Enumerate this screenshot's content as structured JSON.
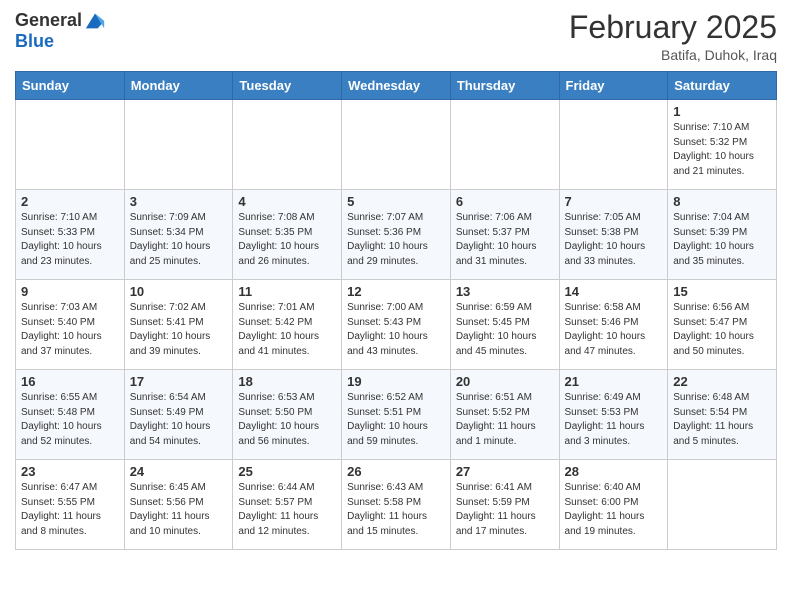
{
  "header": {
    "logo_general": "General",
    "logo_blue": "Blue",
    "month_title": "February 2025",
    "location": "Batifa, Duhok, Iraq"
  },
  "weekdays": [
    "Sunday",
    "Monday",
    "Tuesday",
    "Wednesday",
    "Thursday",
    "Friday",
    "Saturday"
  ],
  "weeks": [
    [
      {
        "day": "",
        "info": ""
      },
      {
        "day": "",
        "info": ""
      },
      {
        "day": "",
        "info": ""
      },
      {
        "day": "",
        "info": ""
      },
      {
        "day": "",
        "info": ""
      },
      {
        "day": "",
        "info": ""
      },
      {
        "day": "1",
        "info": "Sunrise: 7:10 AM\nSunset: 5:32 PM\nDaylight: 10 hours\nand 21 minutes."
      }
    ],
    [
      {
        "day": "2",
        "info": "Sunrise: 7:10 AM\nSunset: 5:33 PM\nDaylight: 10 hours\nand 23 minutes."
      },
      {
        "day": "3",
        "info": "Sunrise: 7:09 AM\nSunset: 5:34 PM\nDaylight: 10 hours\nand 25 minutes."
      },
      {
        "day": "4",
        "info": "Sunrise: 7:08 AM\nSunset: 5:35 PM\nDaylight: 10 hours\nand 26 minutes."
      },
      {
        "day": "5",
        "info": "Sunrise: 7:07 AM\nSunset: 5:36 PM\nDaylight: 10 hours\nand 29 minutes."
      },
      {
        "day": "6",
        "info": "Sunrise: 7:06 AM\nSunset: 5:37 PM\nDaylight: 10 hours\nand 31 minutes."
      },
      {
        "day": "7",
        "info": "Sunrise: 7:05 AM\nSunset: 5:38 PM\nDaylight: 10 hours\nand 33 minutes."
      },
      {
        "day": "8",
        "info": "Sunrise: 7:04 AM\nSunset: 5:39 PM\nDaylight: 10 hours\nand 35 minutes."
      }
    ],
    [
      {
        "day": "9",
        "info": "Sunrise: 7:03 AM\nSunset: 5:40 PM\nDaylight: 10 hours\nand 37 minutes."
      },
      {
        "day": "10",
        "info": "Sunrise: 7:02 AM\nSunset: 5:41 PM\nDaylight: 10 hours\nand 39 minutes."
      },
      {
        "day": "11",
        "info": "Sunrise: 7:01 AM\nSunset: 5:42 PM\nDaylight: 10 hours\nand 41 minutes."
      },
      {
        "day": "12",
        "info": "Sunrise: 7:00 AM\nSunset: 5:43 PM\nDaylight: 10 hours\nand 43 minutes."
      },
      {
        "day": "13",
        "info": "Sunrise: 6:59 AM\nSunset: 5:45 PM\nDaylight: 10 hours\nand 45 minutes."
      },
      {
        "day": "14",
        "info": "Sunrise: 6:58 AM\nSunset: 5:46 PM\nDaylight: 10 hours\nand 47 minutes."
      },
      {
        "day": "15",
        "info": "Sunrise: 6:56 AM\nSunset: 5:47 PM\nDaylight: 10 hours\nand 50 minutes."
      }
    ],
    [
      {
        "day": "16",
        "info": "Sunrise: 6:55 AM\nSunset: 5:48 PM\nDaylight: 10 hours\nand 52 minutes."
      },
      {
        "day": "17",
        "info": "Sunrise: 6:54 AM\nSunset: 5:49 PM\nDaylight: 10 hours\nand 54 minutes."
      },
      {
        "day": "18",
        "info": "Sunrise: 6:53 AM\nSunset: 5:50 PM\nDaylight: 10 hours\nand 56 minutes."
      },
      {
        "day": "19",
        "info": "Sunrise: 6:52 AM\nSunset: 5:51 PM\nDaylight: 10 hours\nand 59 minutes."
      },
      {
        "day": "20",
        "info": "Sunrise: 6:51 AM\nSunset: 5:52 PM\nDaylight: 11 hours\nand 1 minute."
      },
      {
        "day": "21",
        "info": "Sunrise: 6:49 AM\nSunset: 5:53 PM\nDaylight: 11 hours\nand 3 minutes."
      },
      {
        "day": "22",
        "info": "Sunrise: 6:48 AM\nSunset: 5:54 PM\nDaylight: 11 hours\nand 5 minutes."
      }
    ],
    [
      {
        "day": "23",
        "info": "Sunrise: 6:47 AM\nSunset: 5:55 PM\nDaylight: 11 hours\nand 8 minutes."
      },
      {
        "day": "24",
        "info": "Sunrise: 6:45 AM\nSunset: 5:56 PM\nDaylight: 11 hours\nand 10 minutes."
      },
      {
        "day": "25",
        "info": "Sunrise: 6:44 AM\nSunset: 5:57 PM\nDaylight: 11 hours\nand 12 minutes."
      },
      {
        "day": "26",
        "info": "Sunrise: 6:43 AM\nSunset: 5:58 PM\nDaylight: 11 hours\nand 15 minutes."
      },
      {
        "day": "27",
        "info": "Sunrise: 6:41 AM\nSunset: 5:59 PM\nDaylight: 11 hours\nand 17 minutes."
      },
      {
        "day": "28",
        "info": "Sunrise: 6:40 AM\nSunset: 6:00 PM\nDaylight: 11 hours\nand 19 minutes."
      },
      {
        "day": "",
        "info": ""
      }
    ]
  ]
}
